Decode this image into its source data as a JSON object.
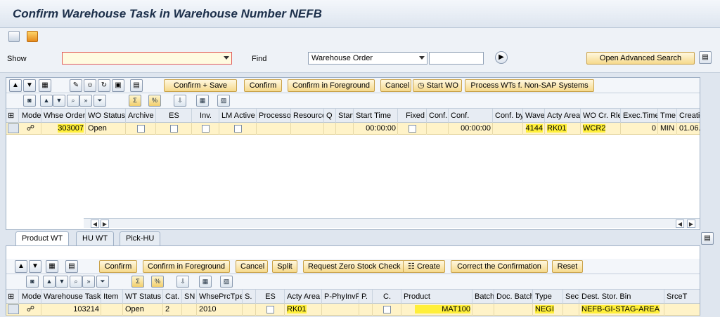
{
  "window": {
    "title": "Confirm Warehouse Task in Warehouse Number NEFB"
  },
  "search": {
    "show_label": "Show",
    "show_value": "",
    "find_label": "Find",
    "find_select": "Warehouse Order",
    "find_value": "",
    "advanced_button": "Open Advanced Search"
  },
  "top_toolbar": {
    "buttons": [
      "Confirm + Save",
      "Confirm",
      "Confirm in Foreground",
      "Cancel",
      "Start WO",
      "Process WTs f. Non-SAP Systems"
    ]
  },
  "order_table": {
    "columns": [
      "Mode",
      "Whse Order",
      "WO Status",
      "Archive",
      "ES",
      "Inv.",
      "LM Active",
      "Processor",
      "Resource",
      "Q",
      "Start",
      "Start Time",
      "Fixed",
      "Conf.",
      "Conf.",
      "Conf. by",
      "Wave",
      "Acty Area",
      "WO Cr. Rle",
      "Exec.Time",
      "Tme",
      "Creatio"
    ],
    "row": {
      "whse_order": "303007",
      "wo_status": "Open",
      "start_time": "00:00:00",
      "conf_time": "00:00:00",
      "wave": "4144",
      "acty_area": "RK01",
      "wo_cr_rle": "WCR2",
      "exec_time": "0",
      "tme": "MIN",
      "creation": "01.06."
    }
  },
  "tabs": [
    {
      "label": "Product WT",
      "active": true
    },
    {
      "label": "HU WT",
      "active": false
    },
    {
      "label": "Pick-HU",
      "active": false
    }
  ],
  "task_toolbar": {
    "buttons": [
      "Confirm",
      "Confirm in Foreground",
      "Cancel",
      "Split",
      "Request Zero Stock Check",
      "Create",
      "Correct the Confirmation",
      "Reset"
    ]
  },
  "task_table": {
    "columns": [
      "Mode",
      "Warehouse Task",
      "Item",
      "WT Status",
      "Cat.",
      "SN",
      "WhsePrcTpe",
      "S.",
      "ES",
      "Acty Area",
      "P-PhyInvPI",
      "P.",
      "C.",
      "Product",
      "Batch",
      "Doc. Batch",
      "Type",
      "Sec.",
      "Dest. Stor. Bin",
      "SrceT"
    ],
    "row": {
      "warehouse_task": "103214",
      "wt_status": "Open",
      "cat": "2",
      "whse_prc_tpe": "2010",
      "acty_area": "RK01",
      "product": "MAT100",
      "type": "NEGI",
      "dest_bin": "NEFB-GI-STAG-AREA"
    }
  },
  "colors": {
    "highlight": "#ffef3a",
    "row_selected": "#fff3c8",
    "button_gold": "#f6d98c"
  }
}
